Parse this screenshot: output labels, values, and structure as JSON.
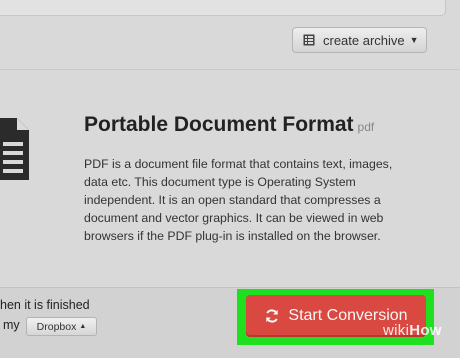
{
  "toolbar": {
    "create_archive_label": "create archive"
  },
  "format": {
    "title": "Portable Document Format",
    "extension": "pdf",
    "description": "PDF is a document file format that contains text, images, data etc. This document type is Operating System independent. It is an open standard that compresses a document and vector graphics. It can be viewed in web browsers if the PDF plug-in is installed on the browser.",
    "icon": "document-icon"
  },
  "footer": {
    "notify_text": "hen it is finished",
    "my_label": "my",
    "dropbox_label": "Dropbox",
    "start_label": "Start Conversion"
  },
  "watermark": {
    "wiki": "wiki",
    "how": "How"
  },
  "colors": {
    "start_button": "#d94841",
    "highlight": "#1ee01e"
  }
}
